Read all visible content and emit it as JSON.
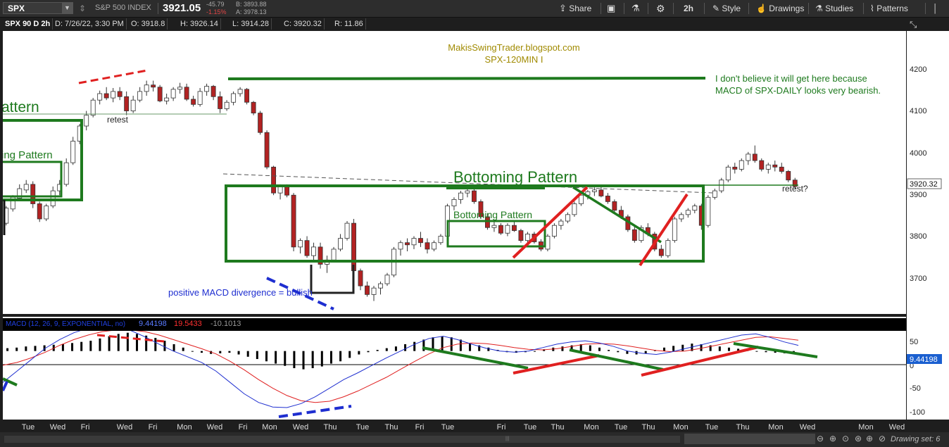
{
  "toolbar": {
    "symbol": "SPX",
    "symbol_name": "S&P 500 INDEX",
    "price": "3921.05",
    "change": "-45.79",
    "change_pct": "-1.15%",
    "bid": "B: 3893.88",
    "ask": "A: 3978.13",
    "share_label": "Share",
    "timeframe": "2h",
    "style_label": "Style",
    "drawings_label": "Drawings",
    "studies_label": "Studies",
    "patterns_label": "Patterns"
  },
  "info": {
    "title": "SPX 90 D 2h",
    "date": "D: 7/26/22, 3:30 PM",
    "open": "O: 3918.8",
    "high": "H: 3926.14",
    "low": "L: 3914.28",
    "close": "C: 3920.32",
    "range": "R: 11.86"
  },
  "annotations": {
    "site": "MakisSwingTrader.blogspot.com",
    "sub": "SPX-120MIN  I",
    "note1": "I don't believe it will get here because",
    "note2": "MACD of SPX-DAILY looks very bearish.",
    "pattern_left": "attern",
    "pattern_left2": "ing Pattern",
    "retest": "retest",
    "bottoming_big": "Bottoming Pattern",
    "bottoming_small": "Bottoming Pattern",
    "retest_q": "retest?",
    "macd_div": "positive MACD divergence = bullish"
  },
  "price_scale": {
    "ticks": [
      "4200",
      "4100",
      "4000",
      "3900",
      "3800",
      "3700"
    ],
    "current": "3920.32"
  },
  "macd": {
    "label": "MACD (12, 26, 9, EXPONENTIAL, no)",
    "value": "9.44198",
    "avg": "19.5433",
    "diff": "-10.1013",
    "ticks": [
      "50",
      "0",
      "-50",
      "-100"
    ],
    "current": "9.44198"
  },
  "xaxis": {
    "labels": [
      "Tue",
      "Wed",
      "Fri",
      "Wed",
      "Fri",
      "Mon",
      "Wed",
      "Fri",
      "Mon",
      "Wed",
      "Thu",
      "Tue",
      "Thu",
      "Fri",
      "Tue",
      "Fri",
      "Tue",
      "Thu",
      "Mon",
      "Tue",
      "Thu",
      "Mon",
      "Tue",
      "Thu",
      "Mon",
      "Wed",
      "Mon",
      "Wed"
    ]
  },
  "footer": {
    "drawing_set": "Drawing set: 6"
  },
  "chart_data": {
    "type": "candlestick",
    "title": "SPX 90 D 2h",
    "ylim": [
      3625,
      4280
    ],
    "candles": [
      [
        3835,
        3875,
        3830,
        3870
      ],
      [
        3868,
        3900,
        3862,
        3895
      ],
      [
        3893,
        3925,
        3888,
        3915
      ],
      [
        3912,
        3935,
        3905,
        3925
      ],
      [
        3925,
        3932,
        3870,
        3880
      ],
      [
        3880,
        3885,
        3838,
        3845
      ],
      [
        3845,
        3880,
        3840,
        3875
      ],
      [
        3875,
        3920,
        3870,
        3910
      ],
      [
        3910,
        3935,
        3900,
        3925
      ],
      [
        3925,
        3985,
        3920,
        3975
      ],
      [
        3975,
        4035,
        3970,
        4025
      ],
      [
        4025,
        4065,
        4018,
        4060
      ],
      [
        4060,
        4095,
        4050,
        4085
      ],
      [
        4085,
        4125,
        4080,
        4120
      ],
      [
        4120,
        4142,
        4110,
        4135
      ],
      [
        4135,
        4150,
        4120,
        4125
      ],
      [
        4125,
        4148,
        4115,
        4140
      ],
      [
        4140,
        4150,
        4120,
        4128
      ],
      [
        4128,
        4140,
        4085,
        4095
      ],
      [
        4095,
        4130,
        4090,
        4120
      ],
      [
        4120,
        4150,
        4115,
        4140
      ],
      [
        4140,
        4165,
        4130,
        4155
      ],
      [
        4155,
        4165,
        4140,
        4150
      ],
      [
        4150,
        4155,
        4115,
        4118
      ],
      [
        4118,
        4135,
        4110,
        4125
      ],
      [
        4125,
        4150,
        4118,
        4145
      ],
      [
        4145,
        4160,
        4135,
        4150
      ],
      [
        4150,
        4158,
        4118,
        4122
      ],
      [
        4122,
        4130,
        4105,
        4110
      ],
      [
        4110,
        4148,
        4105,
        4140
      ],
      [
        4140,
        4158,
        4130,
        4152
      ],
      [
        4152,
        4155,
        4120,
        4128
      ],
      [
        4128,
        4140,
        4090,
        4100
      ],
      [
        4100,
        4120,
        4095,
        4115
      ],
      [
        4115,
        4140,
        4108,
        4135
      ],
      [
        4135,
        4150,
        4128,
        4145
      ],
      [
        4145,
        4148,
        4110,
        4115
      ],
      [
        4115,
        4118,
        4085,
        4090
      ],
      [
        4090,
        4095,
        4040,
        4045
      ],
      [
        4045,
        4050,
        3960,
        3965
      ],
      [
        3965,
        3968,
        3900,
        3905
      ],
      [
        3905,
        3925,
        3890,
        3920
      ],
      [
        3920,
        3925,
        3895,
        3900
      ],
      [
        3900,
        3905,
        3770,
        3780
      ],
      [
        3780,
        3800,
        3765,
        3795
      ],
      [
        3795,
        3805,
        3755,
        3760
      ],
      [
        3760,
        3790,
        3750,
        3780
      ],
      [
        3780,
        3790,
        3730,
        3740
      ],
      [
        3740,
        3760,
        3720,
        3750
      ],
      [
        3750,
        3780,
        3745,
        3775
      ],
      [
        3775,
        3810,
        3770,
        3800
      ],
      [
        3800,
        3840,
        3795,
        3835
      ],
      [
        3835,
        3845,
        3715,
        3725
      ],
      [
        3725,
        3730,
        3680,
        3690
      ],
      [
        3690,
        3700,
        3665,
        3670
      ],
      [
        3670,
        3690,
        3655,
        3685
      ],
      [
        3685,
        3700,
        3670,
        3695
      ],
      [
        3695,
        3720,
        3690,
        3715
      ],
      [
        3715,
        3780,
        3710,
        3775
      ],
      [
        3775,
        3795,
        3760,
        3790
      ],
      [
        3790,
        3800,
        3770,
        3785
      ],
      [
        3785,
        3805,
        3775,
        3800
      ],
      [
        3800,
        3815,
        3780,
        3790
      ],
      [
        3790,
        3800,
        3765,
        3775
      ],
      [
        3775,
        3795,
        3770,
        3790
      ],
      [
        3790,
        3810,
        3785,
        3805
      ],
      [
        3805,
        3880,
        3800,
        3875
      ],
      [
        3875,
        3895,
        3865,
        3890
      ],
      [
        3890,
        3910,
        3880,
        3905
      ],
      [
        3905,
        3920,
        3895,
        3910
      ],
      [
        3910,
        3920,
        3880,
        3885
      ],
      [
        3885,
        3890,
        3845,
        3850
      ],
      [
        3850,
        3858,
        3820,
        3825
      ],
      [
        3825,
        3838,
        3815,
        3830
      ],
      [
        3830,
        3835,
        3808,
        3812
      ],
      [
        3812,
        3835,
        3805,
        3830
      ],
      [
        3830,
        3840,
        3815,
        3818
      ],
      [
        3818,
        3822,
        3790,
        3795
      ],
      [
        3795,
        3815,
        3785,
        3810
      ],
      [
        3810,
        3815,
        3788,
        3792
      ],
      [
        3792,
        3798,
        3770,
        3775
      ],
      [
        3775,
        3810,
        3770,
        3805
      ],
      [
        3805,
        3835,
        3800,
        3830
      ],
      [
        3830,
        3845,
        3820,
        3840
      ],
      [
        3840,
        3860,
        3835,
        3855
      ],
      [
        3855,
        3885,
        3850,
        3880
      ],
      [
        3880,
        3905,
        3875,
        3900
      ],
      [
        3900,
        3912,
        3890,
        3908
      ],
      [
        3908,
        3918,
        3898,
        3912
      ],
      [
        3912,
        3920,
        3895,
        3898
      ],
      [
        3898,
        3905,
        3880,
        3885
      ],
      [
        3885,
        3890,
        3860,
        3865
      ],
      [
        3865,
        3875,
        3845,
        3850
      ],
      [
        3850,
        3855,
        3815,
        3820
      ],
      [
        3820,
        3830,
        3790,
        3795
      ],
      [
        3795,
        3830,
        3790,
        3825
      ],
      [
        3825,
        3835,
        3805,
        3810
      ],
      [
        3810,
        3815,
        3770,
        3775
      ],
      [
        3775,
        3785,
        3755,
        3760
      ],
      [
        3760,
        3800,
        3755,
        3795
      ],
      [
        3795,
        3850,
        3790,
        3845
      ],
      [
        3845,
        3860,
        3838,
        3855
      ],
      [
        3855,
        3870,
        3848,
        3865
      ],
      [
        3865,
        3880,
        3858,
        3875
      ],
      [
        3875,
        3880,
        3820,
        3830
      ],
      [
        3830,
        3900,
        3825,
        3895
      ],
      [
        3895,
        3915,
        3890,
        3910
      ],
      [
        3910,
        3940,
        3905,
        3935
      ],
      [
        3935,
        3970,
        3930,
        3965
      ],
      [
        3965,
        3975,
        3950,
        3960
      ],
      [
        3960,
        3985,
        3955,
        3980
      ],
      [
        3980,
        4000,
        3970,
        3995
      ],
      [
        3995,
        4015,
        3975,
        3980
      ],
      [
        3980,
        3985,
        3955,
        3960
      ],
      [
        3960,
        3975,
        3950,
        3970
      ],
      [
        3970,
        3980,
        3955,
        3965
      ],
      [
        3965,
        3975,
        3950,
        3955
      ],
      [
        3955,
        3958,
        3930,
        3935
      ],
      [
        3935,
        3940,
        3915,
        3920
      ]
    ],
    "macd_hist": [
      5,
      6,
      8,
      9,
      10,
      11,
      12,
      14,
      16,
      18,
      22,
      26,
      30,
      32,
      30,
      27,
      23,
      18,
      12,
      6,
      0,
      -3,
      -5,
      -4,
      -3,
      -6,
      -10,
      -14,
      -18,
      -22,
      -26,
      -30,
      -32,
      -30,
      -27,
      -22,
      -18,
      -12,
      -6,
      -2,
      2,
      5,
      8,
      12,
      16,
      20,
      24,
      26,
      24,
      20,
      14,
      10,
      6,
      2,
      -2,
      -3,
      -2,
      0,
      3,
      6,
      8,
      10,
      12,
      10,
      6,
      2,
      -2,
      -5,
      -6,
      -4,
      2,
      6,
      9,
      11,
      13,
      12,
      10,
      8,
      6,
      4,
      2,
      -1,
      -2,
      -3,
      -4,
      -4
    ],
    "macd_line": [
      -55,
      -35,
      -15,
      5,
      20,
      32,
      40,
      44,
      42,
      36,
      25,
      12,
      0,
      -10,
      -20,
      -35,
      -55,
      -75,
      -90,
      -98,
      -99,
      -92,
      -80,
      -65,
      -50,
      -38,
      -25,
      -12,
      0,
      12,
      22,
      26,
      20,
      12,
      5,
      0,
      -2,
      0,
      6,
      12,
      16,
      18,
      14,
      8,
      0,
      -4,
      -6,
      -2,
      4,
      10,
      16,
      22,
      28,
      30,
      24,
      16,
      10
    ],
    "signal_line": [
      -25,
      -20,
      -12,
      -2,
      10,
      20,
      28,
      34,
      37,
      37,
      34,
      28,
      20,
      12,
      4,
      -5,
      -18,
      -33,
      -50,
      -65,
      -78,
      -87,
      -90,
      -88,
      -80,
      -70,
      -58,
      -46,
      -32,
      -18,
      -5,
      6,
      12,
      14,
      13,
      10,
      6,
      3,
      2,
      4,
      8,
      12,
      13,
      12,
      9,
      5,
      1,
      -1,
      0,
      4,
      9,
      14,
      19,
      24,
      25,
      22,
      19
    ],
    "macd_ylim": [
      -120,
      60
    ]
  }
}
